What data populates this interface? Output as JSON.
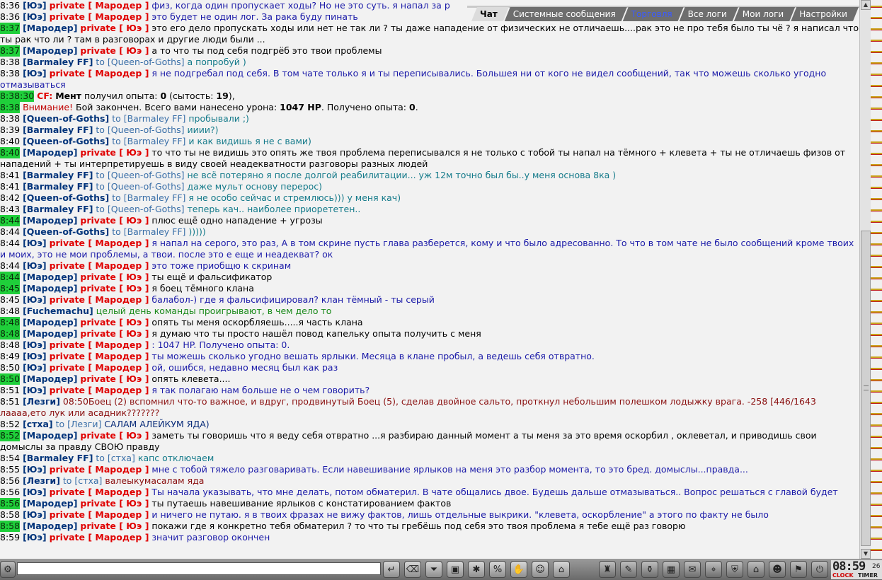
{
  "tabs": [
    {
      "label": "Чат",
      "state": "active"
    },
    {
      "label": "Системные сообщения",
      "state": "normal"
    },
    {
      "label": "Торговля",
      "state": "blue"
    },
    {
      "label": "Все логи",
      "state": "normal"
    },
    {
      "label": "Мои логи",
      "state": "normal"
    },
    {
      "label": "Настройки",
      "state": "normal"
    }
  ],
  "messages": [
    {
      "time": "8:36",
      "hl": false,
      "nick": "[Юэ]",
      "private": "private [ Мародер ]",
      "to": "",
      "text": "физ, когда один пропускает ходы? Но не это суть. я напал за р",
      "style": "blue"
    },
    {
      "time": "8:36",
      "hl": false,
      "nick": "[Юэ]",
      "private": "private [ Мародер ]",
      "to": "",
      "text": "это будет не один лог. За рака буду пинать",
      "style": "blue"
    },
    {
      "time": "8:37",
      "hl": true,
      "nick": "[Мародер]",
      "private": "private [ Юэ ]",
      "to": "",
      "text": "это его дело пропускать ходы или нет не так ли ? ты даже нападение от физических не отличаешь....рак это не про тебя было ты чё ? я написал что ты рак что ли ? там в разговорах и другие люди были ...",
      "style": "normal"
    },
    {
      "time": "8:37",
      "hl": true,
      "nick": "[Мародер]",
      "private": "private [ Юэ ]",
      "to": "",
      "text": "а то что ты под себя подгрёб это твои проблемы",
      "style": "normal"
    },
    {
      "time": "8:38",
      "hl": false,
      "nick": "[Barmaley FF]",
      "private": "",
      "to": "to [Queen-of-Goths]",
      "text": "а попробуй )",
      "style": "teal"
    },
    {
      "time": "8:38",
      "hl": false,
      "nick": "[Юэ]",
      "private": "private [ Мародер ]",
      "to": "",
      "text": "я не подгребал под себя. В том чате только я и ты переписывались. Большея ни от кого не видел сообщений, так что можешь сколько угодно отмазываться",
      "style": "blue"
    },
    {
      "time": "8:38:30",
      "hl": true,
      "kind": "sys",
      "label": "CF:",
      "parts": [
        "Мент",
        " получил опыта: ",
        "0",
        " (сытость: ",
        "19",
        "),"
      ]
    },
    {
      "time": "8:38",
      "hl": true,
      "kind": "alert",
      "label": "Внимание!",
      "parts": [
        " Бой закончен. Всего вами нанесено урона: ",
        "1047 HP",
        ". Получено опыта: ",
        "0",
        "."
      ]
    },
    {
      "time": "8:38",
      "hl": false,
      "nick": "[Queen-of-Goths]",
      "private": "",
      "to": "to [Barmaley FF]",
      "text": "пробывали ;)",
      "style": "teal"
    },
    {
      "time": "8:39",
      "hl": false,
      "nick": "[Barmaley FF]",
      "private": "",
      "to": "to [Queen-of-Goths]",
      "text": "ииии?)",
      "style": "teal"
    },
    {
      "time": "8:40",
      "hl": false,
      "nick": "[Queen-of-Goths]",
      "private": "",
      "to": "to [Barmaley FF]",
      "text": "и как видишь я не с вами)",
      "style": "teal"
    },
    {
      "time": "8:40",
      "hl": true,
      "nick": "[Мародер]",
      "private": "private [ Юэ ]",
      "to": "",
      "text": "то что ты не видишь это опять же твоя проблема переписывался я не только с тобой ты напал на тёмного + клевета + ты не отличаешь физов от нападений + ты интерпретируешь в виду своей неадекватности разговоры разных людей",
      "style": "normal"
    },
    {
      "time": "8:41",
      "hl": false,
      "nick": "[Barmaley FF]",
      "private": "",
      "to": "to [Queen-of-Goths]",
      "text": "не всё потеряно я после долгой реабилитации... уж 12м точно был бы..у меня основа 8ка )",
      "style": "teal"
    },
    {
      "time": "8:41",
      "hl": false,
      "nick": "[Barmaley FF]",
      "private": "",
      "to": "to [Queen-of-Goths]",
      "text": "даже мульт основу перерос)",
      "style": "teal"
    },
    {
      "time": "8:42",
      "hl": false,
      "nick": "[Queen-of-Goths]",
      "private": "",
      "to": "to [Barmaley FF]",
      "text": "я не особо сейчас и стремлюсь))) у меня кач)",
      "style": "teal"
    },
    {
      "time": "8:43",
      "hl": false,
      "nick": "[Barmaley FF]",
      "private": "",
      "to": "to [Queen-of-Goths]",
      "text": "теперь кач.. наиболее приорететен..",
      "style": "teal"
    },
    {
      "time": "8:44",
      "hl": true,
      "nick": "[Мародер]",
      "private": "private [ Юэ ]",
      "to": "",
      "text": "плюс ещё одно нападение + угрозы",
      "style": "normal"
    },
    {
      "time": "8:44",
      "hl": false,
      "nick": "[Queen-of-Goths]",
      "private": "",
      "to": "to [Barmaley FF]",
      "text": ")))))",
      "style": "teal"
    },
    {
      "time": "8:44",
      "hl": false,
      "nick": "[Юэ]",
      "private": "private [ Мародер ]",
      "to": "",
      "text": "я напал на серого, это раз, А в том скрине пусть глава разберется, кому и что было адресованно. То что в том чате не было сообщений кроме твоих и моих, это не мои проблемы, а твои. после это е еще и неадекват? ок",
      "style": "blue"
    },
    {
      "time": "8:44",
      "hl": false,
      "nick": "[Юэ]",
      "private": "private [ Мародер ]",
      "to": "",
      "text": "это тоже приобщю к скринам",
      "style": "blue"
    },
    {
      "time": "8:44",
      "hl": true,
      "nick": "[Мародер]",
      "private": "private [ Юэ ]",
      "to": "",
      "text": "ты ещё и фальсификатор",
      "style": "normal"
    },
    {
      "time": "8:45",
      "hl": true,
      "nick": "[Мародер]",
      "private": "private [ Юэ ]",
      "to": "",
      "text": "я боец тёмного клана",
      "style": "normal"
    },
    {
      "time": "8:45",
      "hl": false,
      "nick": "[Юэ]",
      "private": "private [ Мародер ]",
      "to": "",
      "text": "балабол-) где я фальсифицировал? клан тёмный - ты серый",
      "style": "blue"
    },
    {
      "time": "8:48",
      "hl": false,
      "nick": "[Fuchemachu]",
      "private": "",
      "to": "",
      "text": "целый день команды проигрывают, в чем дело то",
      "style": "green"
    },
    {
      "time": "8:48",
      "hl": true,
      "nick": "[Мародер]",
      "private": "private [ Юэ ]",
      "to": "",
      "text": "опять ты меня оскорбляешь.....я часть клана",
      "style": "normal"
    },
    {
      "time": "8:48",
      "hl": true,
      "nick": "[Мародер]",
      "private": "private [ Юэ ]",
      "to": "",
      "text": "я думаю что ты просто нашёл повод капельку опыта получить с меня",
      "style": "normal"
    },
    {
      "time": "8:48",
      "hl": false,
      "nick": "[Юэ]",
      "private": "private [ Мародер ]",
      "to": "",
      "text": ": 1047 HP. Получено опыта: 0.",
      "style": "blue"
    },
    {
      "time": "8:49",
      "hl": false,
      "nick": "[Юэ]",
      "private": "private [ Мародер ]",
      "to": "",
      "text": "ты можешь сколько угодно вешать ярлыки. Месяца в клане пробыл, а ведешь себя отвратно.",
      "style": "blue"
    },
    {
      "time": "8:50",
      "hl": false,
      "nick": "[Юэ]",
      "private": "private [ Мародер ]",
      "to": "",
      "text": "ой, ошибся, недавно месяц был как раз",
      "style": "blue"
    },
    {
      "time": "8:50",
      "hl": true,
      "nick": "[Мародер]",
      "private": "private [ Юэ ]",
      "to": "",
      "text": "опять клевета....",
      "style": "normal"
    },
    {
      "time": "8:51",
      "hl": false,
      "nick": "[Юэ]",
      "private": "private [ Мародер ]",
      "to": "",
      "text": "я так полагаю нам больше не о чем говорить?",
      "style": "blue"
    },
    {
      "time": "8:51",
      "hl": false,
      "nick": "[Лезги]",
      "private": "",
      "to": "",
      "text": "08:50Боец (2) вспомнил что-то важное, и вдруг, продвинутый Боец (5), сделав двойное сальто, проткнул небольшим полешком лодыжку врага. -258 [446/1643 лаааа,ето лук или асадник???????",
      "style": "maroon"
    },
    {
      "time": "8:52",
      "hl": false,
      "nick": "[стха]",
      "private": "",
      "to": "to [Лезги]",
      "text": "САЛАМ АЛЕЙКУМ ЯДА)",
      "style": "dblue"
    },
    {
      "time": "8:52",
      "hl": true,
      "nick": "[Мародер]",
      "private": "private [ Юэ ]",
      "to": "",
      "text": "заметь ты говоришь что я веду себя отвратно ...я разбираю данный момент а ты меня за это время оскорбил , оклеветал, и приводишь свои домыслы за правду СВОЮ правду",
      "style": "normal"
    },
    {
      "time": "8:54",
      "hl": false,
      "nick": "[Barmaley FF]",
      "private": "",
      "to": "to [стха]",
      "text": "капс отключаем",
      "style": "teal"
    },
    {
      "time": "8:55",
      "hl": false,
      "nick": "[Юэ]",
      "private": "private [ Мародер ]",
      "to": "",
      "text": "мне с тобой тяжело разговаривать. Если навешивание ярлыков на меня это разбор момента, то это бред. домыслы...правда...",
      "style": "blue"
    },
    {
      "time": "8:56",
      "hl": false,
      "nick": "[Лезги]",
      "private": "",
      "to": "to [стха]",
      "text": "валеыкумасалам яда",
      "style": "maroon"
    },
    {
      "time": "8:56",
      "hl": false,
      "nick": "[Юэ]",
      "private": "private [ Мародер ]",
      "to": "",
      "text": "Ты начала указывать, что мне делать, потом обматерил. В чате общались двое. Будешь дальше отмазываться.. Вопрос решаться с главой будет",
      "style": "blue"
    },
    {
      "time": "8:56",
      "hl": true,
      "nick": "[Мародер]",
      "private": "private [ Юэ ]",
      "to": "",
      "text": "ты путаешь навешивание ярлыков с констатированием фактов",
      "style": "normal"
    },
    {
      "time": "8:58",
      "hl": false,
      "nick": "[Юэ]",
      "private": "private [ Мародер ]",
      "to": "",
      "text": "и ничего не путаю. я в твоих фразах не вижу фактов, лишь отдельные выкрики. \"клевета, оскорбление\" а этого по факту не было",
      "style": "blue"
    },
    {
      "time": "8:58",
      "hl": true,
      "nick": "[Мародер]",
      "private": "private [ Юэ ]",
      "to": "",
      "text": "покажи где я конкретно тебя обматерил ? то что ты гребёшь под себя это твоя проблема я тебе ещё раз говорю",
      "style": "normal"
    },
    {
      "time": "8:59",
      "hl": false,
      "nick": "[Юэ]",
      "private": "private [ Мародер ]",
      "to": "",
      "text": "значит разговор окончен",
      "style": "blue"
    }
  ],
  "input": {
    "value": "",
    "placeholder": ""
  },
  "toolbar_icons": [
    "enter-icon",
    "eraser-icon",
    "filter-icon",
    "log-icon",
    "fighter-icon",
    "percent-icon",
    "hand-icon",
    "smiley-icon",
    "chat-lock-icon"
  ],
  "tray_icons": [
    "bag-icon",
    "wand-icon",
    "potion-icon",
    "chest-icon",
    "scroll-icon",
    "map-icon",
    "shield-icon",
    "house-icon",
    "friends-icon",
    "flag-icon",
    "exit-icon"
  ],
  "clock": {
    "time": "08:59",
    "seconds": "26",
    "label_left": "CLOCK",
    "label_right": "TIMER",
    "exit_label": "EXIT"
  }
}
